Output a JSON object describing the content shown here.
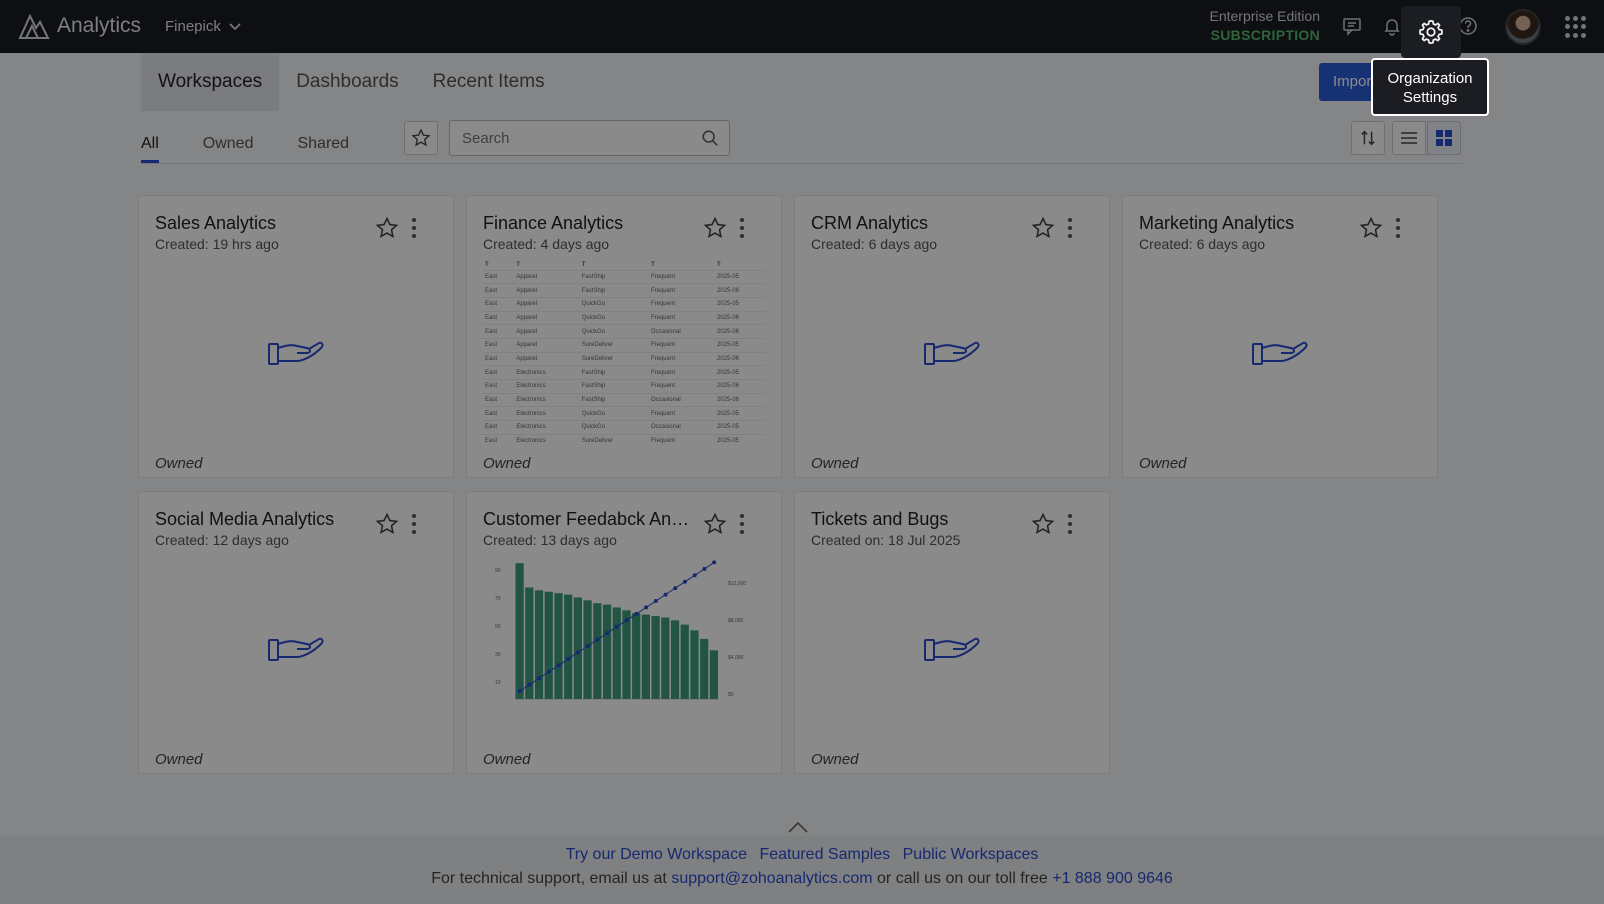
{
  "app": {
    "title": "Analytics",
    "org_name": "Finepick",
    "edition_label": "Enterprise Edition",
    "subscription_label": "SUBSCRIPTION"
  },
  "topbar_icons": [
    "chat-icon",
    "bell-icon",
    "gear-icon",
    "help-icon",
    "avatar",
    "apps-grid-icon"
  ],
  "tooltip": {
    "line1": "Organization",
    "line2": "Settings"
  },
  "tabs": [
    {
      "label": "Workspaces",
      "active": true
    },
    {
      "label": "Dashboards",
      "active": false
    },
    {
      "label": "Recent Items",
      "active": false
    }
  ],
  "import_button": "Import",
  "filters": [
    {
      "label": "All",
      "active": true
    },
    {
      "label": "Owned",
      "active": false
    },
    {
      "label": "Shared",
      "active": false
    }
  ],
  "search": {
    "placeholder": "Search",
    "value": ""
  },
  "workspaces": [
    {
      "title": "Sales Analytics",
      "subtitle": "Created: 19 hrs ago",
      "owner": "Owned",
      "thumb": "hand"
    },
    {
      "title": "Finance Analytics",
      "subtitle": "Created: 4 days ago",
      "owner": "Owned",
      "thumb": "table"
    },
    {
      "title": "CRM Analytics",
      "subtitle": "Created: 6 days ago",
      "owner": "Owned",
      "thumb": "hand"
    },
    {
      "title": "Marketing Analytics",
      "subtitle": "Created: 6 days ago",
      "owner": "Owned",
      "thumb": "hand"
    },
    {
      "title": "Social Media Analytics",
      "subtitle": "Created: 12 days ago",
      "owner": "Owned",
      "thumb": "hand"
    },
    {
      "title": "Customer Feedabck Anal...",
      "subtitle": "Created: 13 days ago",
      "owner": "Owned",
      "thumb": "chart"
    },
    {
      "title": "Tickets and Bugs",
      "subtitle": "Created on: 18 Jul 2025",
      "owner": "Owned",
      "thumb": "hand"
    }
  ],
  "finance_table_rows": [
    [
      "East",
      "Apparel",
      "FastShip",
      "Frequent",
      "2025-05"
    ],
    [
      "East",
      "Apparel",
      "FastShip",
      "Frequent",
      "2025-06"
    ],
    [
      "East",
      "Apparel",
      "QuickGo",
      "Frequent",
      "2025-05"
    ],
    [
      "East",
      "Apparel",
      "QuickGo",
      "Frequent",
      "2025-06"
    ],
    [
      "East",
      "Apparel",
      "QuickGo",
      "Occasional",
      "2025-06"
    ],
    [
      "East",
      "Apparel",
      "SureDeliver",
      "Frequent",
      "2025-05"
    ],
    [
      "East",
      "Apparel",
      "SureDeliver",
      "Frequent",
      "2025-06"
    ],
    [
      "East",
      "Electronics",
      "FastShip",
      "Frequent",
      "2025-05"
    ],
    [
      "East",
      "Electronics",
      "FastShip",
      "Frequent",
      "2025-06"
    ],
    [
      "East",
      "Electronics",
      "FastShip",
      "Occasional",
      "2025-06"
    ],
    [
      "East",
      "Electronics",
      "QuickGo",
      "Frequent",
      "2025-05"
    ],
    [
      "East",
      "Electronics",
      "QuickGo",
      "Occasional",
      "2025-05"
    ],
    [
      "East",
      "Electronics",
      "SureDeliver",
      "Frequent",
      "2025-05"
    ]
  ],
  "pareto_thumb": {
    "bars": [
      95,
      78,
      76,
      75,
      74,
      73,
      71,
      69,
      67,
      66,
      64,
      62,
      60,
      59,
      58,
      57,
      55,
      52,
      48,
      42,
      34
    ],
    "left_ticks": [
      "90",
      "70",
      "50",
      "30",
      "10"
    ],
    "right_ticks": [
      "$12,000",
      "$8,000",
      "$4,000",
      "$0"
    ],
    "bar_color": "#3d9c7c",
    "line_color": "#2a4bd0"
  },
  "footer": {
    "links": [
      "Try our Demo Workspace",
      "Featured Samples",
      "Public Workspaces"
    ],
    "support_prefix": "For technical support, email us at",
    "support_email": "support@zohoanalytics.com",
    "support_middle": "or call us on our toll free",
    "support_phone": "+1 888 900 9646"
  },
  "colors": {
    "topbar": "#1b1d22",
    "accent": "#2a4bd0",
    "subscription": "#58b96d",
    "overlay": "rgba(0,0,0,0.46)"
  }
}
